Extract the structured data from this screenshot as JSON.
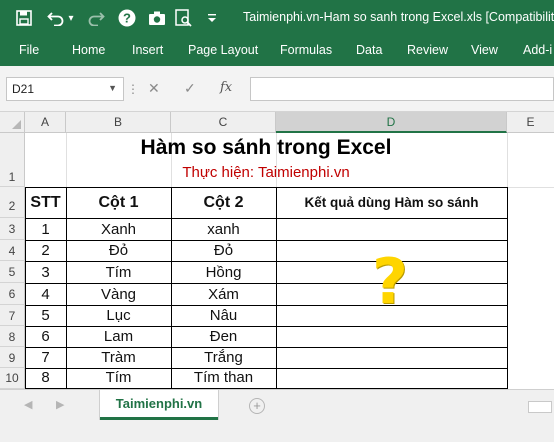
{
  "app": {
    "title": "Taimienphi.vn-Ham so sanh trong Excel.xls  [Compatibility",
    "accent_color": "#217346",
    "quick_access": [
      {
        "icon": "save-icon",
        "glyph": "💾"
      },
      {
        "icon": "undo-icon",
        "glyph": "↶"
      },
      {
        "icon": "undo-dropdown-icon",
        "glyph": "▾"
      },
      {
        "icon": "redo-icon",
        "glyph": "↷"
      },
      {
        "icon": "help-icon",
        "glyph": "?"
      },
      {
        "icon": "camera-icon",
        "glyph": "▣"
      },
      {
        "icon": "print-preview-icon",
        "glyph": "⎙"
      },
      {
        "icon": "customize-dropdown-icon",
        "glyph": "▾"
      }
    ]
  },
  "ribbon": {
    "tabs": [
      "File",
      "Home",
      "Insert",
      "Page Layout",
      "Formulas",
      "Data",
      "Review",
      "View",
      "Add-i"
    ]
  },
  "formula_bar": {
    "name_box": "D21",
    "cancel_glyph": "✕",
    "enter_glyph": "✓",
    "fx_glyph": "fx",
    "value": ""
  },
  "columns": [
    "A",
    "B",
    "C",
    "D",
    "E"
  ],
  "selected_column": "D",
  "rows": [
    "1",
    "2",
    "3",
    "4",
    "5",
    "6",
    "7",
    "8",
    "9",
    "10"
  ],
  "sheet": {
    "title": "Hàm so sánh trong Excel",
    "subtitle": "Thực hiện: Taimienphi.vn",
    "headers": {
      "stt": "STT",
      "col1": "Cột 1",
      "col2": "Cột 2",
      "result": "Kết quả dùng Hàm so sánh"
    },
    "data": [
      {
        "stt": "1",
        "col1": "Xanh",
        "col2": "xanh"
      },
      {
        "stt": "2",
        "col1": "Đỏ",
        "col2": "Đỏ"
      },
      {
        "stt": "3",
        "col1": "Tím",
        "col2": "Hồng"
      },
      {
        "stt": "4",
        "col1": "Vàng",
        "col2": "Xám"
      },
      {
        "stt": "5",
        "col1": "Lục",
        "col2": "Nâu"
      },
      {
        "stt": "6",
        "col1": "Lam",
        "col2": "Đen"
      },
      {
        "stt": "7",
        "col1": "Tràm",
        "col2": "Trắng"
      },
      {
        "stt": "8",
        "col1": "Tím",
        "col2": "Tím than"
      }
    ],
    "question_mark": "?",
    "question_color": "#ffd500"
  },
  "sheet_tabs": {
    "active": "Taimienphi.vn",
    "prev_glyph": "◀",
    "next_glyph": "▶",
    "add_glyph": "+"
  }
}
